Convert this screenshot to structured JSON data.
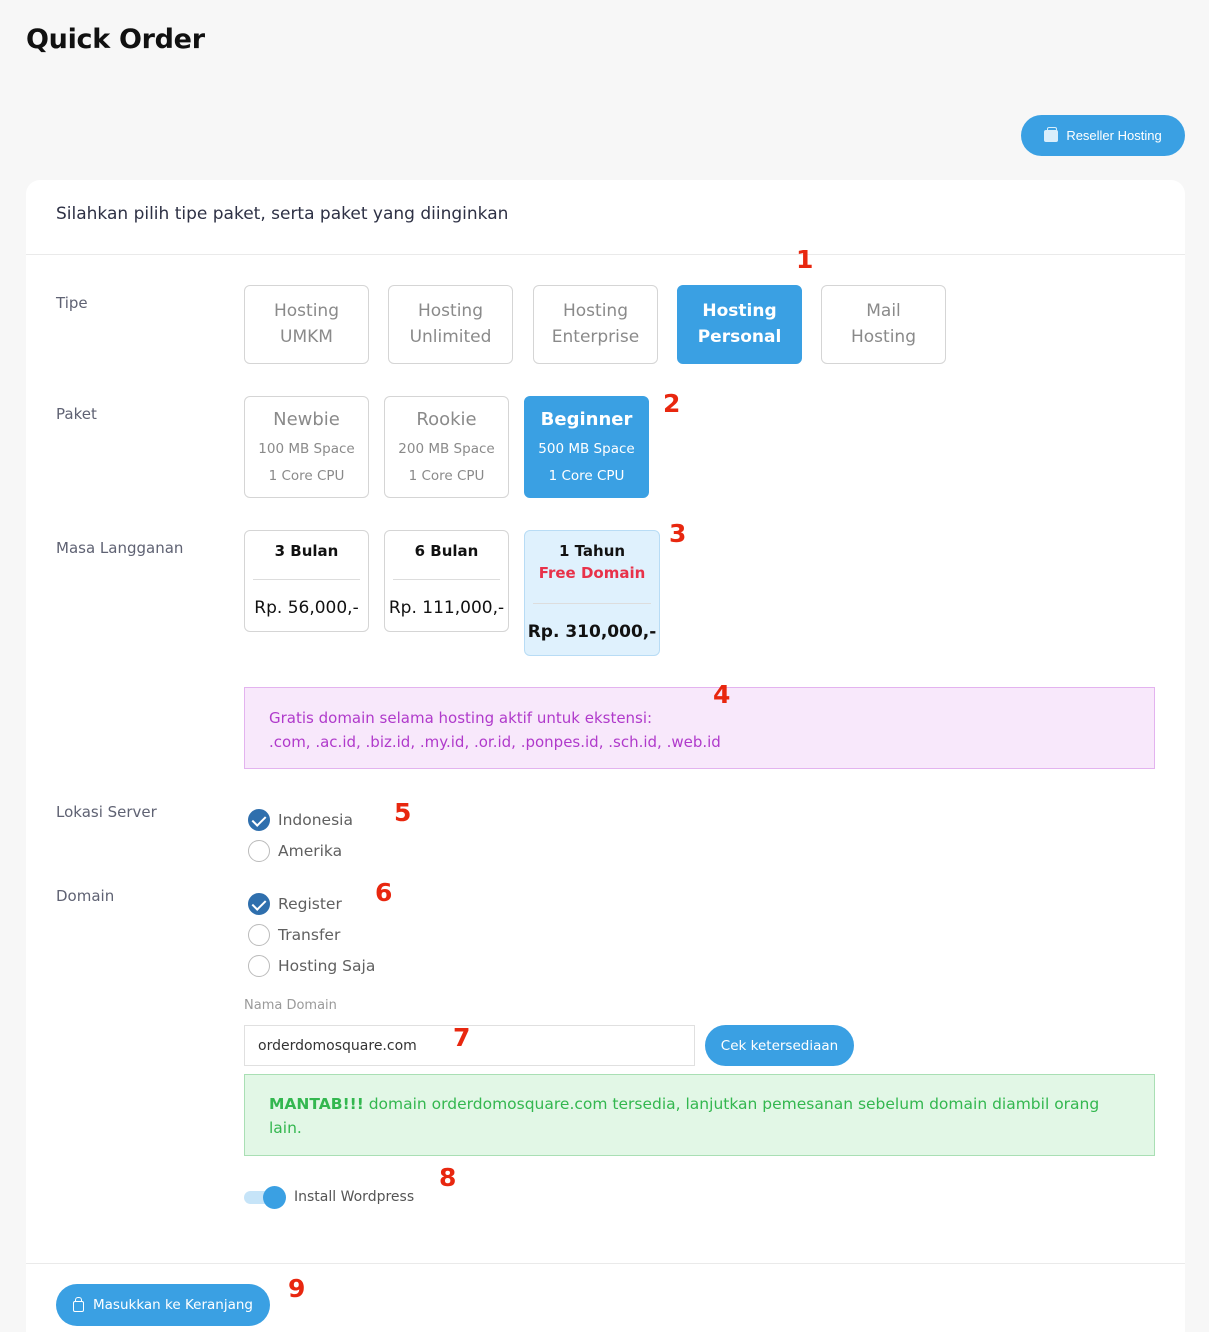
{
  "page_title": "Quick Order",
  "reseller_button": "Reseller Hosting",
  "card_heading": "Silahkan pilih tipe paket, serta paket yang diinginkan",
  "labels": {
    "tipe": "Tipe",
    "paket": "Paket",
    "masa": "Masa Langganan",
    "lokasi": "Lokasi Server",
    "domain": "Domain"
  },
  "markers": [
    "1",
    "2",
    "3",
    "4",
    "5",
    "6",
    "7",
    "8",
    "9"
  ],
  "tipe_options": [
    {
      "line1": "Hosting",
      "line2": "UMKM",
      "selected": false
    },
    {
      "line1": "Hosting",
      "line2": "Unlimited",
      "selected": false
    },
    {
      "line1": "Hosting",
      "line2": "Enterprise",
      "selected": false
    },
    {
      "line1": "Hosting",
      "line2": "Personal",
      "selected": true
    },
    {
      "line1": "Mail",
      "line2": "Hosting",
      "selected": false
    }
  ],
  "paket_options": [
    {
      "name": "Newbie",
      "space": "100 MB Space",
      "cpu": "1 Core CPU",
      "selected": false
    },
    {
      "name": "Rookie",
      "space": "200 MB Space",
      "cpu": "1 Core CPU",
      "selected": false
    },
    {
      "name": "Beginner",
      "space": "500 MB Space",
      "cpu": "1 Core CPU",
      "selected": true
    }
  ],
  "masa_options": [
    {
      "period": "3 Bulan",
      "price": "Rp. 56,000,-",
      "selected": false
    },
    {
      "period": "6 Bulan",
      "price": "Rp. 111,000,-",
      "selected": false
    },
    {
      "period": "1 Tahun",
      "bonus": "Free Domain",
      "price": "Rp. 310,000,-",
      "selected": true
    }
  ],
  "free_domain_info": {
    "line1": "Gratis domain selama hosting aktif untuk ekstensi:",
    "line2": ".com, .ac.id, .biz.id, .my.id, .or.id, .ponpes.id, .sch.id, .web.id"
  },
  "lokasi_options": [
    {
      "label": "Indonesia",
      "checked": true
    },
    {
      "label": "Amerika",
      "checked": false
    }
  ],
  "domain_options": [
    {
      "label": "Register",
      "checked": true
    },
    {
      "label": "Transfer",
      "checked": false
    },
    {
      "label": "Hosting Saja",
      "checked": false
    }
  ],
  "nama_domain": {
    "label": "Nama Domain",
    "value": "orderdomosquare.com",
    "check_button": "Cek ketersediaan"
  },
  "availability": {
    "strong": "MANTAB!!!",
    "message": " domain orderdomosquare.com tersedia, lanjutkan pemesanan sebelum domain diambil orang lain."
  },
  "wordpress_toggle": {
    "label": "Install Wordpress",
    "on": true
  },
  "cart_button": "Masukkan ke Keranjang",
  "colors": {
    "primary": "#3aa0e3",
    "marker": "#e8270f",
    "info_bg": "#f8e8fb",
    "info_text": "#b03acb",
    "success_bg": "#e2f7e6",
    "success_text": "#33b74f",
    "free_domain": "#e8324a"
  }
}
